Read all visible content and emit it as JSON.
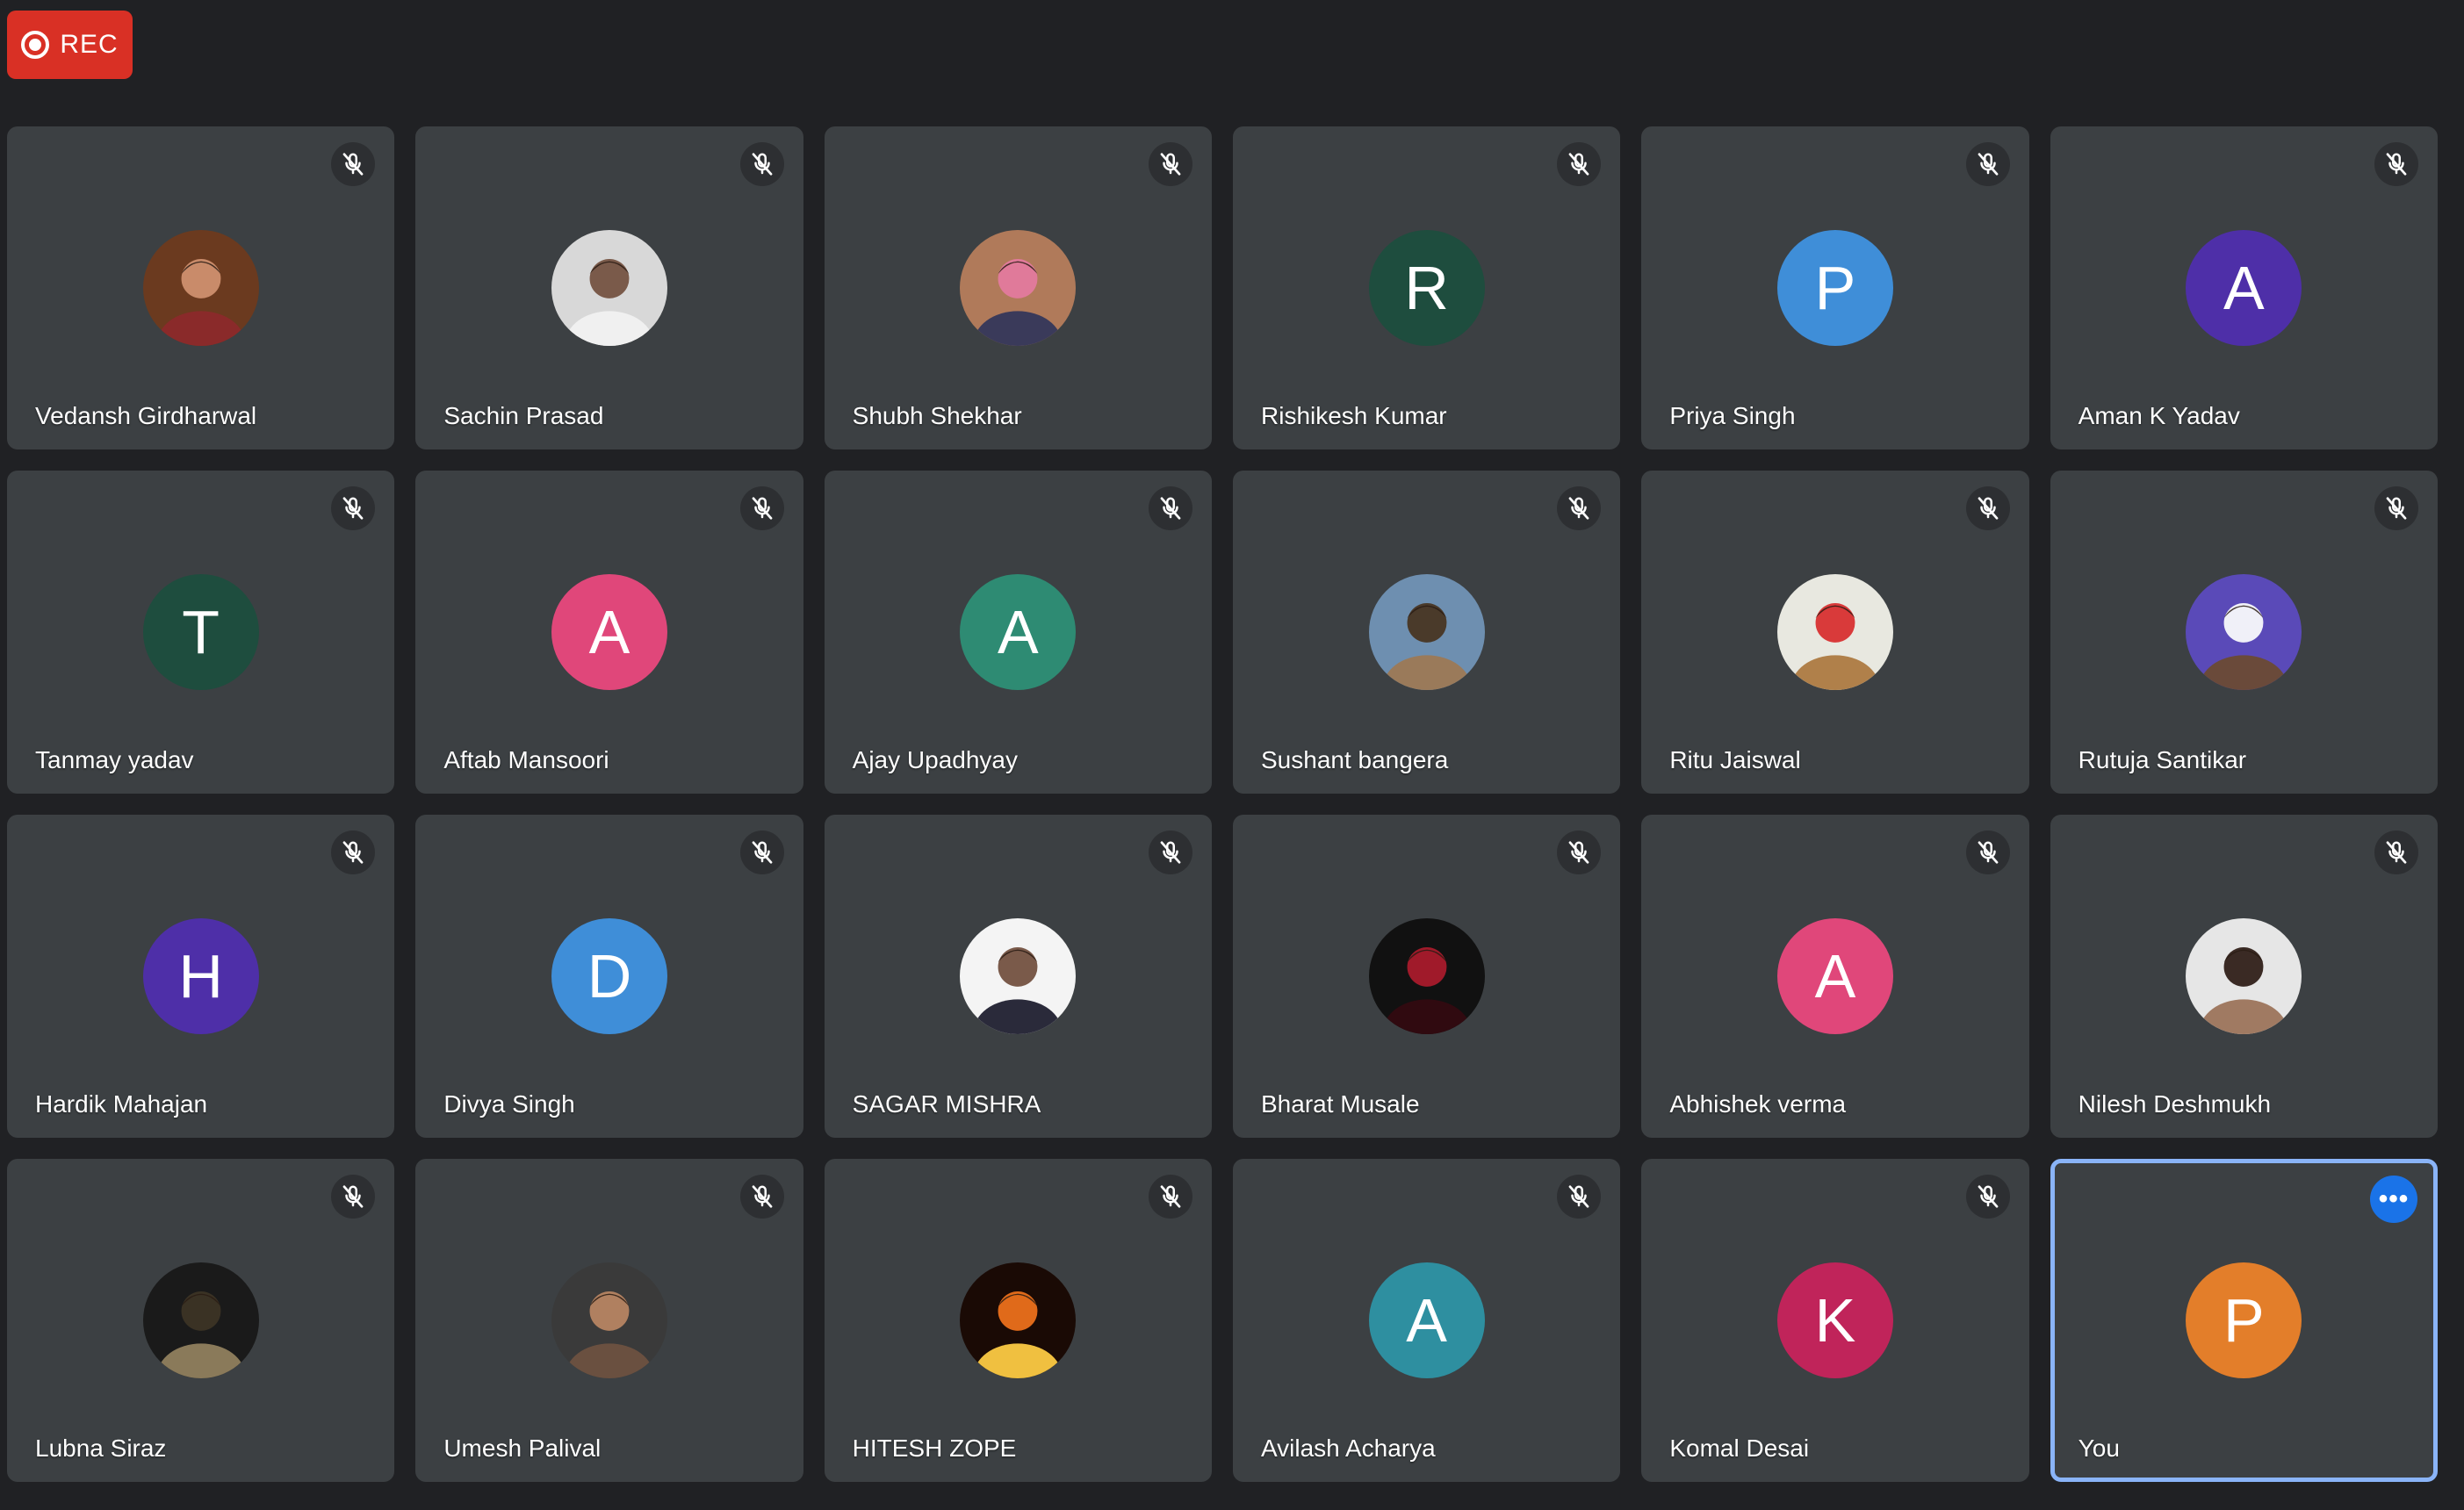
{
  "recording": {
    "label": "REC",
    "color": "#d93025"
  },
  "icons": {
    "mic_off": "mic-off-icon",
    "more_options": "more-options-icon",
    "record": "record-icon"
  },
  "self_border_color": "#8ab4f8",
  "participants": [
    {
      "name": "Vedansh Girdharwal",
      "avatar": {
        "type": "photo",
        "palette": [
          "#6b3a1f",
          "#c98b6a",
          "#8a2a2a"
        ]
      }
    },
    {
      "name": "Sachin Prasad",
      "avatar": {
        "type": "photo",
        "palette": [
          "#d8d8d8",
          "#7a5a4a",
          "#f0f0f0"
        ]
      }
    },
    {
      "name": "Shubh Shekhar",
      "avatar": {
        "type": "photo",
        "palette": [
          "#b07a5a",
          "#e07a9a",
          "#3a3a5a"
        ]
      }
    },
    {
      "name": "Rishikesh Kumar",
      "avatar": {
        "type": "initial",
        "letter": "R",
        "color": "#1e4d3e"
      }
    },
    {
      "name": "Priya Singh",
      "avatar": {
        "type": "initial",
        "letter": "P",
        "color": "#3f8ed8"
      }
    },
    {
      "name": "Aman K Yadav",
      "avatar": {
        "type": "initial",
        "letter": "A",
        "color": "#4e2fa8"
      }
    },
    {
      "name": "Tanmay yadav",
      "avatar": {
        "type": "initial",
        "letter": "T",
        "color": "#1e4d3e"
      }
    },
    {
      "name": "Aftab Mansoori",
      "avatar": {
        "type": "initial",
        "letter": "A",
        "color": "#e0477a"
      }
    },
    {
      "name": "Ajay Upadhyay",
      "avatar": {
        "type": "initial",
        "letter": "A",
        "color": "#2e8b73"
      }
    },
    {
      "name": "Sushant bangera",
      "avatar": {
        "type": "photo",
        "palette": [
          "#6e8fb0",
          "#4a3a2a",
          "#9a7a5a"
        ]
      }
    },
    {
      "name": "Ritu Jaiswal",
      "avatar": {
        "type": "photo",
        "palette": [
          "#e8e8e0",
          "#d93a3a",
          "#b0804a"
        ]
      }
    },
    {
      "name": "Rutuja Santikar",
      "avatar": {
        "type": "photo",
        "palette": [
          "#5a4ab8",
          "#f0f0f8",
          "#6a4a3a"
        ]
      }
    },
    {
      "name": "Hardik Mahajan",
      "avatar": {
        "type": "initial",
        "letter": "H",
        "color": "#4e2fa8"
      }
    },
    {
      "name": "Divya Singh",
      "avatar": {
        "type": "initial",
        "letter": "D",
        "color": "#3f8ed8"
      }
    },
    {
      "name": "SAGAR MISHRA",
      "avatar": {
        "type": "photo",
        "palette": [
          "#f4f4f4",
          "#7a5a4a",
          "#2a2a3a"
        ]
      }
    },
    {
      "name": "Bharat Musale",
      "avatar": {
        "type": "photo",
        "palette": [
          "#111111",
          "#a01a2a",
          "#300a10"
        ]
      }
    },
    {
      "name": "Abhishek verma",
      "avatar": {
        "type": "initial",
        "letter": "A",
        "color": "#e0477a"
      }
    },
    {
      "name": "Nilesh Deshmukh",
      "avatar": {
        "type": "photo",
        "palette": [
          "#e6e6e6",
          "#3a2a24",
          "#a07a62"
        ]
      }
    },
    {
      "name": "Lubna Siraz",
      "avatar": {
        "type": "photo",
        "palette": [
          "#1a1a1a",
          "#3a3224",
          "#8a7a5a"
        ]
      }
    },
    {
      "name": "Umesh Palival",
      "avatar": {
        "type": "photo",
        "palette": [
          "#3a3a3a",
          "#b08060",
          "#6a5040"
        ]
      }
    },
    {
      "name": "HITESH ZOPE",
      "avatar": {
        "type": "photo",
        "palette": [
          "#1a0a05",
          "#e06a1a",
          "#f0c040"
        ]
      }
    },
    {
      "name": "Avilash Acharya",
      "avatar": {
        "type": "initial",
        "letter": "A",
        "color": "#2e8fa0"
      }
    },
    {
      "name": "Komal Desai",
      "avatar": {
        "type": "initial",
        "letter": "K",
        "color": "#c0245a"
      }
    },
    {
      "name": "You",
      "avatar": {
        "type": "initial",
        "letter": "P",
        "color": "#e37e2a"
      },
      "is_self": true
    }
  ]
}
